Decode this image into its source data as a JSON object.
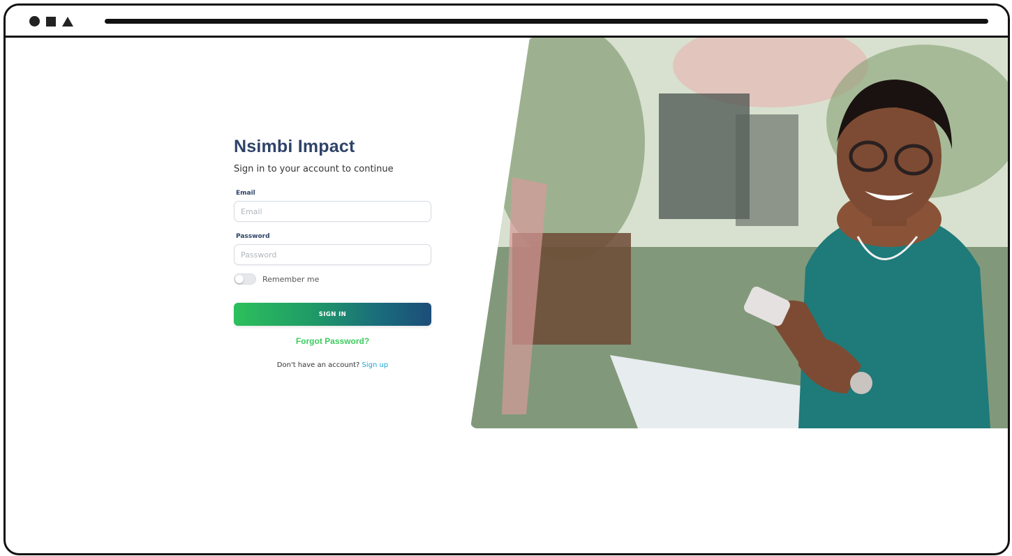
{
  "window": {
    "controls": [
      "circle-icon",
      "square-icon",
      "triangle-icon"
    ]
  },
  "login": {
    "title": "Nsimbi Impact",
    "subtitle": "Sign in to your account to continue",
    "email": {
      "label": "Email",
      "placeholder": "Email",
      "value": ""
    },
    "password": {
      "label": "Password",
      "placeholder": "Password",
      "value": ""
    },
    "remember_me": {
      "label": "Remember me",
      "checked": false
    },
    "sign_in_label": "SIGN IN",
    "forgot_password_label": "Forgot Password?",
    "signup_prompt": "Don't have an account?",
    "signup_link_label": "Sign up"
  },
  "colors": {
    "title": "#2f4368",
    "button_gradient_start": "#2dbf5c",
    "button_gradient_end": "#1c4d79",
    "forgot_link": "#3ccb5f",
    "signup_link": "#1aa3d8"
  }
}
